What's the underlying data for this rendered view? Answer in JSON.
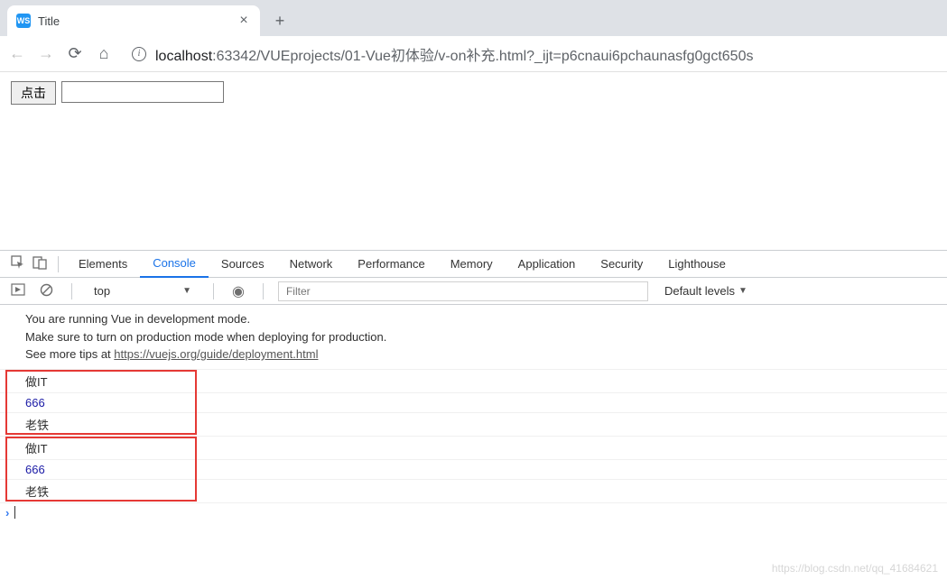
{
  "browser": {
    "tab_title": "Title",
    "favicon_text": "WS",
    "url_host": "localhost",
    "url_path": ":63342/VUEprojects/01-Vue初体验/v-on补充.html?_ijt=p6cnaui6pchaunasfg0gct650s"
  },
  "page": {
    "button_label": "点击"
  },
  "devtools": {
    "tabs": [
      "Elements",
      "Console",
      "Sources",
      "Network",
      "Performance",
      "Memory",
      "Application",
      "Security",
      "Lighthouse"
    ],
    "active_tab": "Console",
    "context": "top",
    "filter_placeholder": "Filter",
    "levels_label": "Default levels",
    "warning_lines": [
      "You are running Vue in development mode.",
      "Make sure to turn on production mode when deploying for production.",
      "See more tips at "
    ],
    "warning_link": "https://vuejs.org/guide/deployment.html",
    "log_groups": [
      [
        "做IT",
        "666",
        "老铁"
      ],
      [
        "做IT",
        "666",
        "老铁"
      ]
    ]
  },
  "watermark": "https://blog.csdn.net/qq_41684621"
}
